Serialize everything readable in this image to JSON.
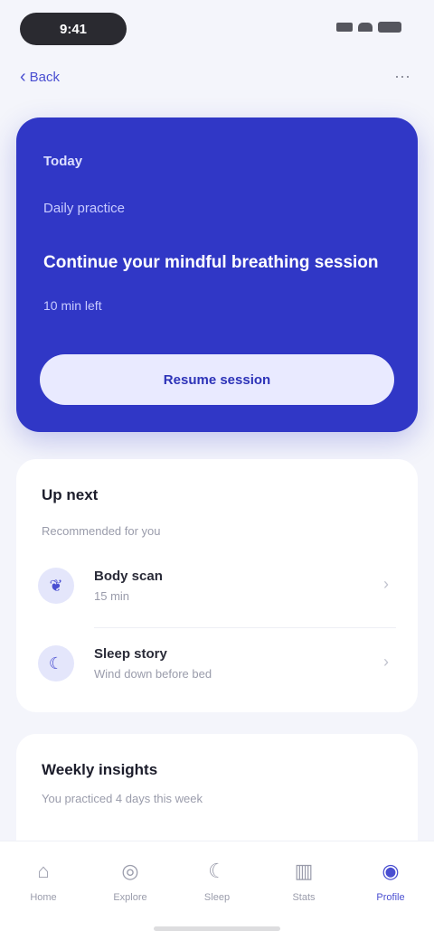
{
  "status_bar": {
    "time": "9:41"
  },
  "nav": {
    "back_label": "Back",
    "more_icon": "more-icon"
  },
  "hero": {
    "eyebrow": "Today",
    "subtitle": "Daily practice",
    "title": "Continue your mindful breathing session",
    "meta": "10 min left",
    "cta_label": "Resume session"
  },
  "sessions": {
    "title": "Up next",
    "subtitle": "Recommended for you",
    "items": [
      {
        "icon": "leaf-icon",
        "title": "Body scan",
        "desc": "15 min"
      },
      {
        "icon": "moon-icon",
        "title": "Sleep story",
        "desc": "Wind down before bed"
      }
    ]
  },
  "insights": {
    "title": "Weekly insights",
    "subtitle": "You practiced 4 days this week"
  },
  "tabs": [
    {
      "label": "Home",
      "icon": "home-icon",
      "active": false
    },
    {
      "label": "Explore",
      "icon": "compass-icon",
      "active": false
    },
    {
      "label": "Sleep",
      "icon": "moon-icon",
      "active": false
    },
    {
      "label": "Stats",
      "icon": "chart-icon",
      "active": false
    },
    {
      "label": "Profile",
      "icon": "user-icon",
      "active": true
    }
  ],
  "colors": {
    "accent": "#3037c6",
    "background": "#f4f5fb",
    "cta_background": "#e9eaff"
  }
}
